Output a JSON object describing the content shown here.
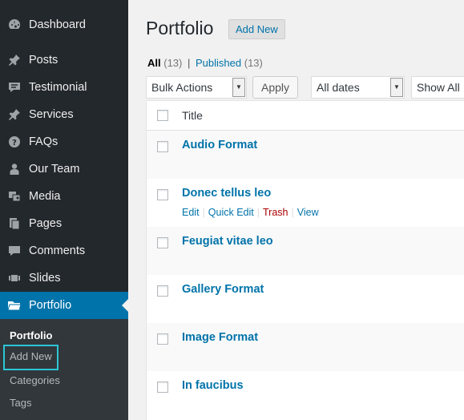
{
  "sidebar": {
    "items": [
      {
        "label": "Dashboard",
        "icon": "dashboard-icon"
      },
      {
        "label": "Posts",
        "icon": "pin-icon"
      },
      {
        "label": "Testimonial",
        "icon": "comment-icon"
      },
      {
        "label": "Services",
        "icon": "pin-icon"
      },
      {
        "label": "FAQs",
        "icon": "question-icon"
      },
      {
        "label": "Our Team",
        "icon": "person-icon"
      },
      {
        "label": "Media",
        "icon": "media-icon"
      },
      {
        "label": "Pages",
        "icon": "pages-icon"
      },
      {
        "label": "Comments",
        "icon": "comment-icon"
      },
      {
        "label": "Slides",
        "icon": "slides-icon"
      },
      {
        "label": "Portfolio",
        "icon": "folder-icon"
      }
    ],
    "submenu": [
      "Portfolio",
      "Add New",
      "Categories",
      "Tags"
    ]
  },
  "main": {
    "title": "Portfolio",
    "add_new": "Add New",
    "filters": {
      "all": "All",
      "all_count": "(13)",
      "separator": "|",
      "published": "Published",
      "published_count": "(13)"
    },
    "bulk_actions": "Bulk Actions",
    "apply": "Apply",
    "all_dates": "All dates",
    "show_all": "Show All"
  },
  "table": {
    "header_title": "Title",
    "rows": [
      "Audio Format",
      "Donec tellus leo",
      "Feugiat vitae leo",
      "Gallery Format",
      "Image Format",
      "In faucibus"
    ],
    "row_actions": [
      "Edit",
      "Quick Edit",
      "Trash",
      "View"
    ]
  },
  "colors": {
    "sidebar_bg": "#23282d",
    "active_bg": "#0073aa",
    "link": "#0073aa",
    "trash": "#aa0000",
    "highlight_box": "#2bc6d6"
  }
}
